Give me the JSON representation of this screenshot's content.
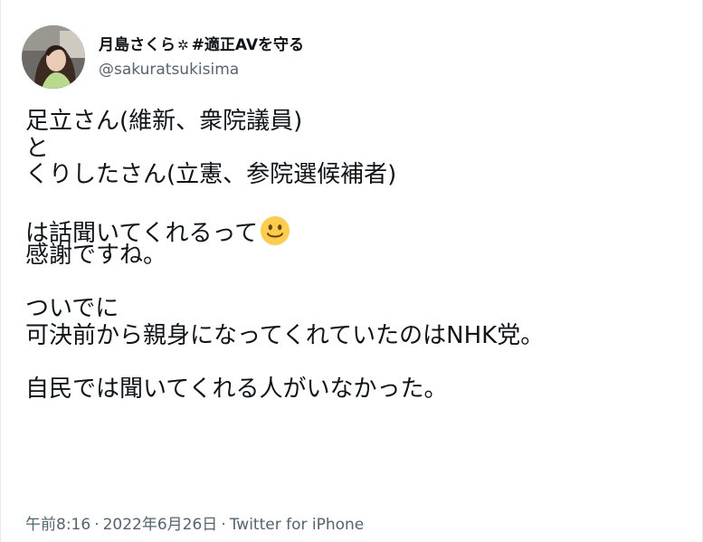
{
  "user": {
    "display_name_prefix": "月島さくら",
    "flower_glyph": "✲",
    "display_name_suffix": "#適正AVを守る",
    "handle": "@sakuratsukisima"
  },
  "tweet": {
    "lines": [
      "足立さん(維新、衆院議員)",
      "と",
      "くりしたさん(立憲、参院選候補者)",
      "",
      "は話聞いてくれるって",
      "感謝ですね。",
      "",
      "ついでに",
      "可決前から親身になってくれていたのはNHK党。",
      "",
      "自民では聞いてくれる人がいなかった。"
    ],
    "emoji": "slightly-smiling-face-icon"
  },
  "meta": {
    "time": "午前8:16",
    "separator": "·",
    "date": "2022年6月26日",
    "source": "Twitter for iPhone"
  },
  "colors": {
    "text": "#0f1419",
    "secondary": "#536471",
    "emoji_face": "#ffcc4d"
  }
}
